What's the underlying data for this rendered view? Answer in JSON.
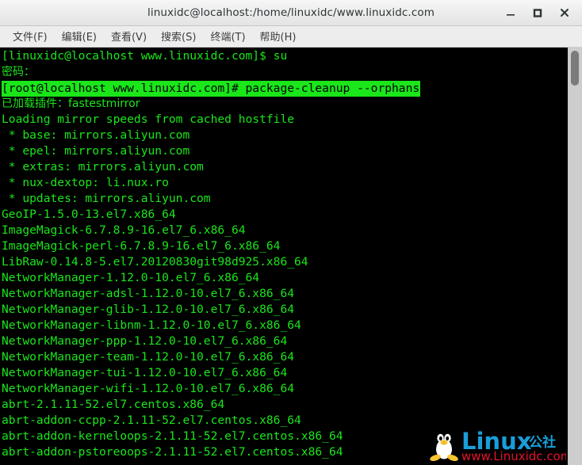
{
  "window": {
    "title": "linuxidc@localhost:/home/linuxidc/www.linuxidc.com",
    "buttons": {
      "minimize": "minimize",
      "maximize": "maximize",
      "close": "close"
    }
  },
  "menubar": {
    "items": [
      {
        "label": "文件(F)"
      },
      {
        "label": "编辑(E)"
      },
      {
        "label": "查看(V)"
      },
      {
        "label": "搜索(S)"
      },
      {
        "label": "终端(T)"
      },
      {
        "label": "帮助(H)"
      }
    ]
  },
  "terminal": {
    "colors": {
      "background": "#000000",
      "foreground": "#1ae61a",
      "highlight_bg": "#1ae61a",
      "highlight_fg": "#000000"
    },
    "lines": [
      {
        "text": "[linuxidc@localhost www.linuxidc.com]$ su",
        "style": "normal"
      },
      {
        "text": "密码：",
        "style": "zh"
      },
      {
        "text": "[root@localhost www.linuxidc.com]# package-cleanup --orphans",
        "style": "highlight"
      },
      {
        "text": "已加载插件：fastestmirror",
        "style": "zh"
      },
      {
        "text": "Loading mirror speeds from cached hostfile",
        "style": "normal"
      },
      {
        "text": " * base: mirrors.aliyun.com",
        "style": "normal"
      },
      {
        "text": " * epel: mirrors.aliyun.com",
        "style": "normal"
      },
      {
        "text": " * extras: mirrors.aliyun.com",
        "style": "normal"
      },
      {
        "text": " * nux-dextop: li.nux.ro",
        "style": "normal"
      },
      {
        "text": " * updates: mirrors.aliyun.com",
        "style": "normal"
      },
      {
        "text": "GeoIP-1.5.0-13.el7.x86_64",
        "style": "normal"
      },
      {
        "text": "ImageMagick-6.7.8.9-16.el7_6.x86_64",
        "style": "normal"
      },
      {
        "text": "ImageMagick-perl-6.7.8.9-16.el7_6.x86_64",
        "style": "normal"
      },
      {
        "text": "LibRaw-0.14.8-5.el7.20120830git98d925.x86_64",
        "style": "normal"
      },
      {
        "text": "NetworkManager-1.12.0-10.el7_6.x86_64",
        "style": "normal"
      },
      {
        "text": "NetworkManager-adsl-1.12.0-10.el7_6.x86_64",
        "style": "normal"
      },
      {
        "text": "NetworkManager-glib-1.12.0-10.el7_6.x86_64",
        "style": "normal"
      },
      {
        "text": "NetworkManager-libnm-1.12.0-10.el7_6.x86_64",
        "style": "normal"
      },
      {
        "text": "NetworkManager-ppp-1.12.0-10.el7_6.x86_64",
        "style": "normal"
      },
      {
        "text": "NetworkManager-team-1.12.0-10.el7_6.x86_64",
        "style": "normal"
      },
      {
        "text": "NetworkManager-tui-1.12.0-10.el7_6.x86_64",
        "style": "normal"
      },
      {
        "text": "NetworkManager-wifi-1.12.0-10.el7_6.x86_64",
        "style": "normal"
      },
      {
        "text": "abrt-2.1.11-52.el7.centos.x86_64",
        "style": "normal"
      },
      {
        "text": "abrt-addon-ccpp-2.1.11-52.el7.centos.x86_64",
        "style": "normal"
      },
      {
        "text": "abrt-addon-kerneloops-2.1.11-52.el7.centos.x86_64",
        "style": "normal"
      },
      {
        "text": "abrt-addon-pstoreoops-2.1.11-52.el7.centos.x86_64",
        "style": "normal"
      }
    ]
  },
  "watermark": {
    "brand": "Linux",
    "suffix": "公社",
    "url": "www.Linuxidc.com",
    "brand_color": "#1a9ed9",
    "url_color": "#e8112d"
  }
}
